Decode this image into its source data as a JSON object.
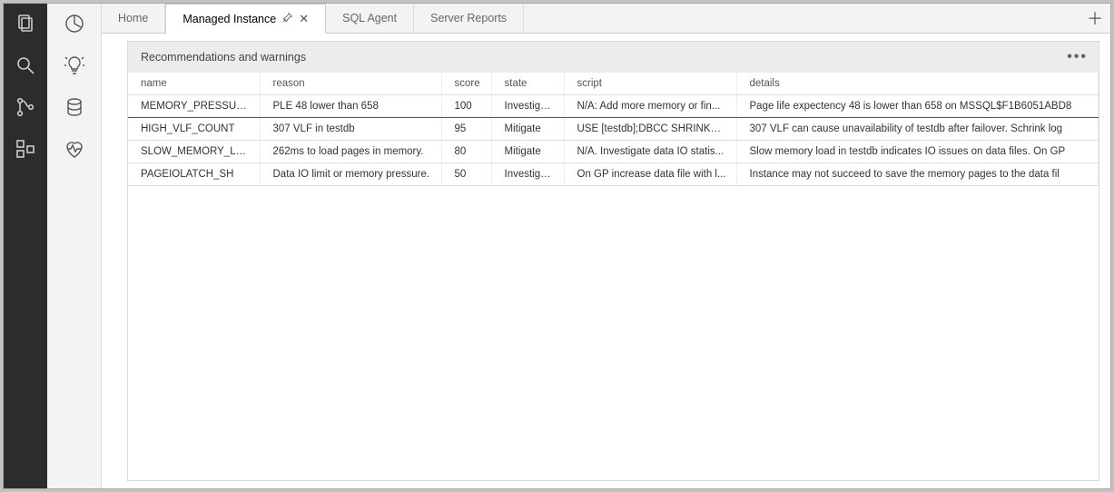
{
  "tabs": [
    {
      "label": "Home",
      "active": false
    },
    {
      "label": "Managed Instance",
      "active": true
    },
    {
      "label": "SQL Agent",
      "active": false
    },
    {
      "label": "Server Reports",
      "active": false
    }
  ],
  "panel": {
    "title": "Recommendations and warnings"
  },
  "table": {
    "columns": [
      "name",
      "reason",
      "score",
      "state",
      "script",
      "details"
    ],
    "rows": [
      {
        "name": "MEMORY_PRESSURE",
        "reason": "PLE 48 lower than 658",
        "score": "100",
        "state": "Investigate",
        "script": "N/A: Add more memory or fin...",
        "details": "Page life expectency 48 is lower than 658 on MSSQL$F1B6051ABD8"
      },
      {
        "name": "HIGH_VLF_COUNT",
        "reason": "307 VLF in testdb",
        "score": "95",
        "state": "Mitigate",
        "script": "USE [testdb];DBCC SHRINKFIL...",
        "details": "307 VLF can cause unavailability of testdb after failover. Schrink log"
      },
      {
        "name": "SLOW_MEMORY_LOAD",
        "reason": "262ms to load pages in memory.",
        "score": "80",
        "state": "Mitigate",
        "script": "N/A. Investigate data IO statis...",
        "details": "Slow memory load in testdb indicates IO issues on data files. On GP"
      },
      {
        "name": "PAGEIOLATCH_SH",
        "reason": "Data IO limit or memory pressure.",
        "score": "50",
        "state": "Investigate",
        "script": "On GP increase data file with l...",
        "details": "Instance may not succeed to save the memory pages to the data fil"
      }
    ]
  }
}
